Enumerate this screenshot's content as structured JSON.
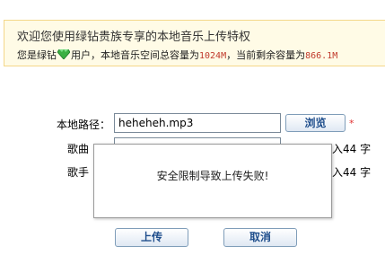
{
  "banner": {
    "title": "欢迎您使用绿钻贵族专享的本地音乐上传特权",
    "info_prefix": "您是绿钻",
    "info_mid": "用户，本地音乐空间总容量为",
    "total_capacity": "1024M",
    "info_mid2": "，当前剩余容量为",
    "remaining_capacity": "866.1M",
    "gem_icon": "green-diamond-icon"
  },
  "form": {
    "path_label": "本地路径：",
    "path_value": "heheheh.mp3",
    "browse_label": "浏览",
    "required_mark": "*",
    "song_label": "歌曲",
    "song_suffix_fragment": "入44 字",
    "singer_label": "歌手",
    "singer_suffix_fragment": "入44 字",
    "upload_label": "上传",
    "cancel_label": "取消"
  },
  "modal": {
    "message": "安全限制导致上传失败!"
  }
}
